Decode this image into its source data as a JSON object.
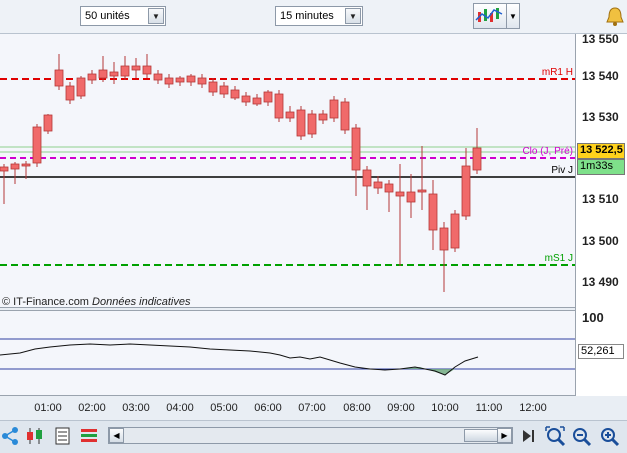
{
  "toolbar": {
    "units_value": "50 unités",
    "timeframe_value": "15 minutes"
  },
  "chart": {
    "y_ticks": [
      "13 550",
      "13 540",
      "13 530",
      "13 520",
      "13 510",
      "13 500",
      "13 490"
    ],
    "x_ticks": [
      "01:00",
      "02:00",
      "03:00",
      "04:00",
      "05:00",
      "06:00",
      "07:00",
      "08:00",
      "09:00",
      "10:00",
      "11:00",
      "12:00"
    ],
    "levels": {
      "r1": "mR1 H",
      "close_prev": "Clo (J, Pré)",
      "pivot": "Piv J",
      "s1": "mS1 J"
    },
    "current_price": "13 522,5",
    "countdown": "1m33s",
    "copyright_brand": "IT-Finance.com",
    "copyright_note": "Données indicatives",
    "colors": {
      "bull": "#40c8f0",
      "bear": "#f06a6a",
      "r1": "#e00000",
      "s1": "#00a000",
      "close_prev": "#d000d0",
      "pivot": "#000000"
    }
  },
  "indicator": {
    "top_level": "100",
    "current_value": "52,261"
  }
}
